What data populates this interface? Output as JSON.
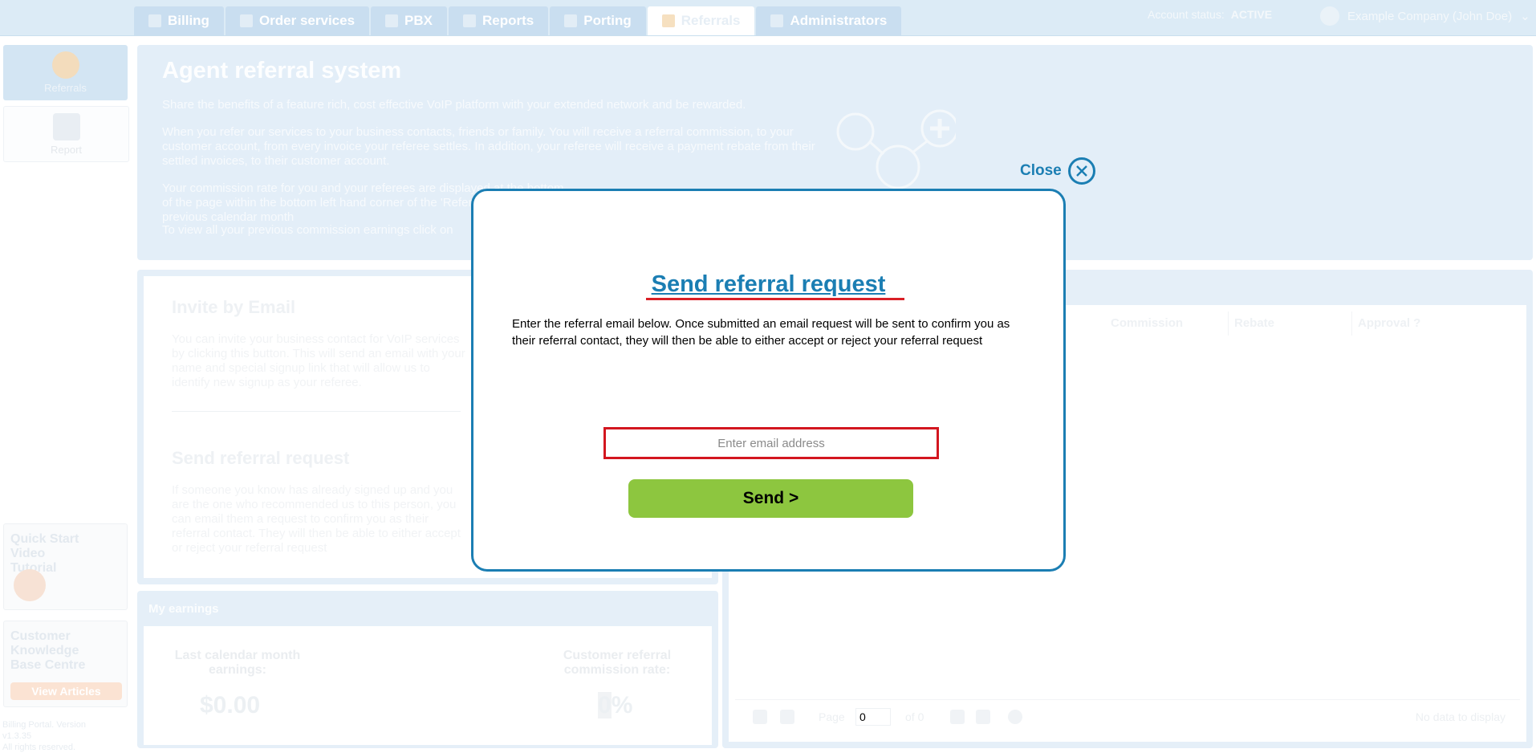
{
  "tabs": [
    {
      "label": "Billing",
      "icon": "coin-icon"
    },
    {
      "label": "Order services",
      "icon": "cart-icon"
    },
    {
      "label": "PBX",
      "icon": "pbx-icon"
    },
    {
      "label": "Reports",
      "icon": "report-icon"
    },
    {
      "label": "Porting",
      "icon": "porting-icon"
    },
    {
      "label": "Referrals",
      "icon": "person-icon",
      "active": true
    },
    {
      "label": "Administrators",
      "icon": "admin-icon"
    }
  ],
  "account": {
    "status_label": "Account status:",
    "status_value": "ACTIVE",
    "user": "Example Company (John Doe)"
  },
  "sidebar": {
    "items": [
      {
        "label": "Referrals"
      },
      {
        "label": "Report"
      }
    ],
    "promo1": "Quick Start Video Tutorial",
    "promo2": "Customer Knowledge Base Centre",
    "promo2_button": "View Articles",
    "version_lines": [
      "Billing Portal. Version",
      "v1.3.35",
      "All rights reserved."
    ]
  },
  "hero": {
    "title": "Agent referral system",
    "p1": "Share the benefits of a feature rich, cost effective VoIP platform with your extended network and be rewarded.",
    "p2": "When you refer our services to your business contacts, friends or family. You will receive a referral commission, to your customer account, from every invoice your referee settles. In addition, your referee will receive a payment rebate from their settled invoices, to their customer account.",
    "p3": "Your commission rate for you and your referees are displayed at the bottom of the page within the bottom left hand corner of the 'Referrals' tab. Your previous calendar month",
    "p4": "To view all your previous commission earnings click on"
  },
  "invite": {
    "title": "Invite by Email",
    "text": "You can invite your business contact for VoIP services by clicking this button. This will send an email with your name and special signup link that will allow us to identify new signup as your referee.",
    "title2": "Send referral request",
    "text2": "If someone you know has already signed up and you are the one who recommended us to this person, you can email them a request to confirm you as their referral contact. They will then be able to either accept or reject your referral request"
  },
  "earnings": {
    "header": "My earnings",
    "last_label": "Last calendar month earnings:",
    "last_value": "$0.00",
    "rate_label": "Customer referral commission rate:",
    "rate_value": "0",
    "rate_suffix": "%"
  },
  "table": {
    "columns": [
      "Commission",
      "Rebate",
      "Approval ?"
    ],
    "pager": {
      "page_label": "Page",
      "page_value": "0",
      "of_label": "of 0",
      "empty": "No data to display"
    }
  },
  "modal": {
    "title": "Send referral request",
    "description": "Enter the referral email below. Once submitted an email request will be sent to confirm you as their referral contact, they will then be able to either accept or reject your referral request",
    "email_placeholder": "Enter email address",
    "send_label": "Send >",
    "close_label": "Close"
  },
  "colors": {
    "accent": "#1b7eb3",
    "send": "#8dc63f",
    "error_border": "#d3161f"
  }
}
